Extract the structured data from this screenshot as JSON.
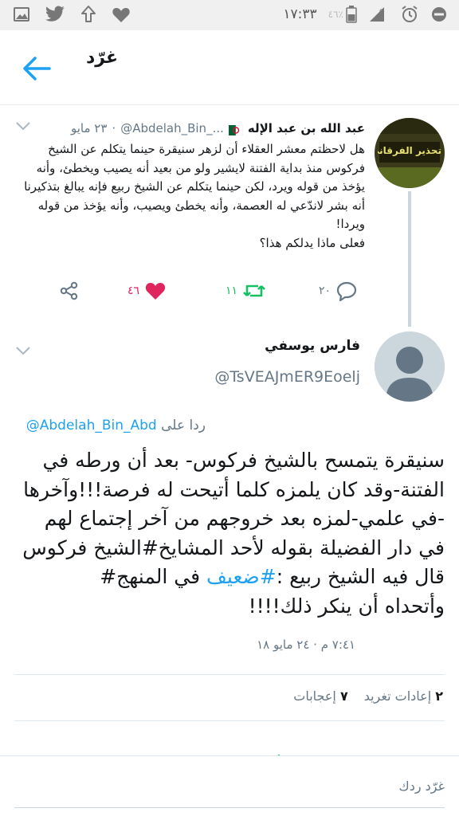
{
  "status_bar": {
    "time": "١٧:٣٣",
    "battery": "٤٦٪",
    "left_icons": [
      "gallery-icon",
      "twitter-icon",
      "upload-icon",
      "heart-icon"
    ],
    "right_icons": [
      "do-not-disturb-icon",
      "alarm-icon",
      "signal-icon",
      "battery-icon"
    ]
  },
  "app_bar": {
    "title": "غرّد"
  },
  "parent_tweet": {
    "author_name": "عبد الله بن عبد الإله",
    "handle": "@Abdelah_Bin_...",
    "separator": "·",
    "date": "٢٣ مايو",
    "text": "هل لاحظتم معشر العقلاء أن لزهر سنيقرة حينما يتكلم عن الشيخ فركوس منذ بداية الفتنة لايشير ولو من بعيد أنه يصيب ويخطئ، وأنه يؤخذ من قوله ويرد، لكن حينما يتكلم عن الشيخ ربيع فإنه يبالغ بتذكيرنا أنه بشر لاندّعي له العصمة، وأنه يخطئ ويصيب، وأنه يؤخذ من قوله ويردا!\nفعلى ماذا يدلكم هذا؟",
    "avatar_text": "تحذير الفرقاني",
    "actions": {
      "reply_count": "٢٠",
      "retweet_count": "١١",
      "like_count": "٤٦"
    }
  },
  "main_tweet": {
    "author_name": "فارس يوسفي",
    "handle": "@TsVEAJmER9Eoelj",
    "reply_prefix": "ردا على",
    "reply_handle": "@Abdelah_Bin_Abd",
    "text_part1": "سنيقرة يتمسح بالشيخ فركوس- بعد أن ورطه في الفتنة-وقد كان يلمزه كلما أتيحت له فرصة!!!وآخرها -في علمي-لمزه بعد خروجهم من آخر إجتماع لهم في دار الفضيلة بقوله لأحد المشايخ#الشيخ فركوس قال فيه الشيخ ربيع :",
    "hashtag": "#ضعيف",
    "text_part2": " في المنهج#\nوأتحداه أن ينكر ذلك!!!!",
    "timestamp": "٧:٤١ م · ٢٤ مايو ١٨",
    "retweets_num": "٢",
    "retweets_label": "إعادات تغريد",
    "likes_num": "٧",
    "likes_label": "إعجابات"
  },
  "reply_bar": {
    "placeholder": "غرّد ردك"
  },
  "colors": {
    "accent": "#1da1f2",
    "retweet_green": "#17bf63",
    "like_red": "#e0245e",
    "muted": "#657786"
  }
}
